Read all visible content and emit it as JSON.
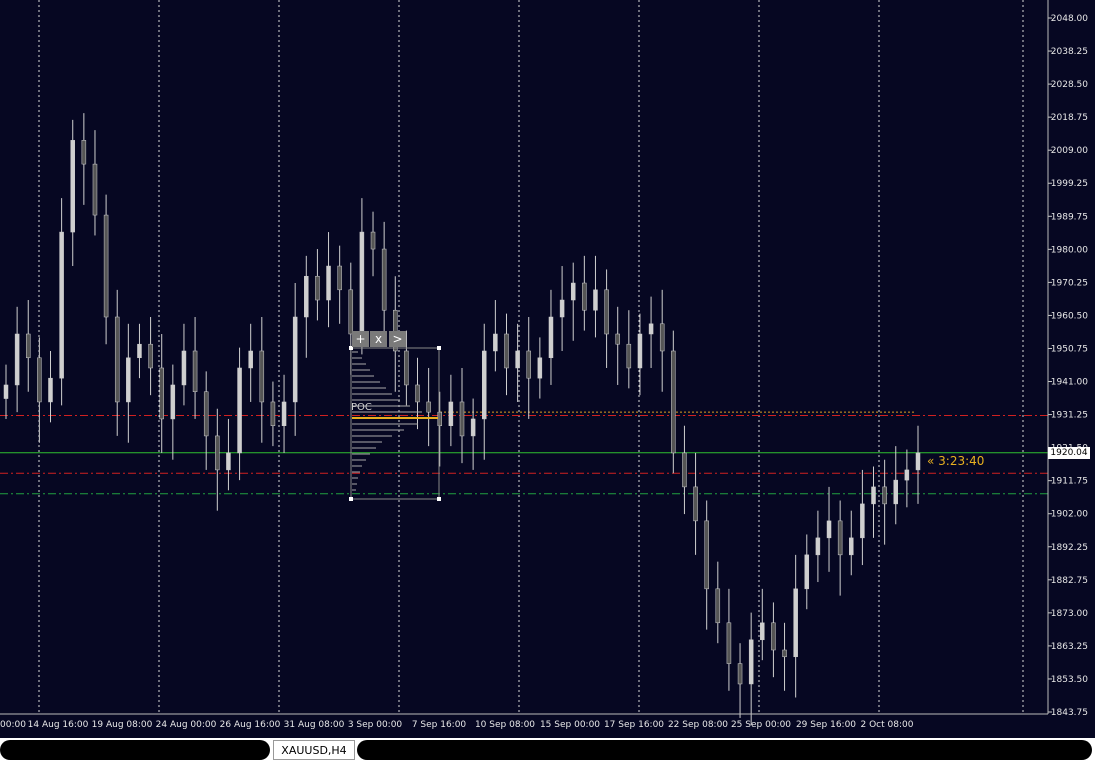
{
  "symbol": "XAUUSD",
  "timeframe": "H4",
  "tab_label": "XAUUSD,H4",
  "price_axis": [
    "2048.00",
    "2038.25",
    "2028.50",
    "2018.75",
    "2009.00",
    "1999.25",
    "1989.75",
    "1980.00",
    "1970.25",
    "1960.50",
    "1950.75",
    "1941.00",
    "1931.25",
    "1921.50",
    "1911.75",
    "1902.00",
    "1892.25",
    "1882.75",
    "1873.00",
    "1863.25",
    "1853.50",
    "1843.75"
  ],
  "time_axis": [
    "00:00",
    "14 Aug 16:00",
    "19 Aug 08:00",
    "24 Aug 00:00",
    "26 Aug 16:00",
    "31 Aug 08:00",
    "3 Sep 00:00",
    "7 Sep 16:00",
    "10 Sep 08:00",
    "15 Sep 00:00",
    "17 Sep 16:00",
    "22 Sep 08:00",
    "25 Sep 00:00",
    "29 Sep 16:00",
    "2 Oct 08:00"
  ],
  "current_price": "1920.04",
  "countdown": "« 3:23:40",
  "volume_profile": {
    "add_label": "+",
    "close_label": "x",
    "next_label": ">",
    "poc_label": "POC"
  },
  "levels": {
    "red_dashed_upper": 1931.0,
    "current": 1920.04,
    "red_dashed_lower": 1914.0,
    "green_dashed": 1908.0,
    "orange_dotted": 1932.0
  },
  "colors": {
    "background": "#060722",
    "candle": "#cfcfcf",
    "grid": "#e0e0e0",
    "current_price_line": "#2fbf2f",
    "red_level": "#d02020",
    "green_level": "#20a040",
    "countdown": "#e8b020"
  },
  "chart_data": {
    "type": "candlestick",
    "series": [
      {
        "name": "XAUUSD,H4",
        "close": [
          1940,
          1955,
          1948,
          1935,
          1942,
          1985,
          2012,
          2005,
          1990,
          1960,
          1935,
          1948,
          1952,
          1945,
          1930,
          1940,
          1950,
          1938,
          1925,
          1915,
          1920,
          1945,
          1950,
          1935,
          1928,
          1935,
          1960,
          1972,
          1965,
          1975,
          1968,
          1955,
          1985,
          1980,
          1962,
          1950,
          1940,
          1935,
          1932,
          1928,
          1935,
          1925,
          1930,
          1950,
          1955,
          1945,
          1950,
          1942,
          1948,
          1960,
          1965,
          1970,
          1962,
          1968,
          1955,
          1952,
          1945,
          1955,
          1958,
          1950,
          1920,
          1910,
          1900,
          1880,
          1870,
          1858,
          1852,
          1865,
          1870,
          1862,
          1860,
          1880,
          1890,
          1895,
          1900,
          1890,
          1895,
          1905,
          1910,
          1905,
          1912,
          1915,
          1920
        ]
      }
    ],
    "ylim": [
      1843.75,
      2052.0
    ]
  }
}
